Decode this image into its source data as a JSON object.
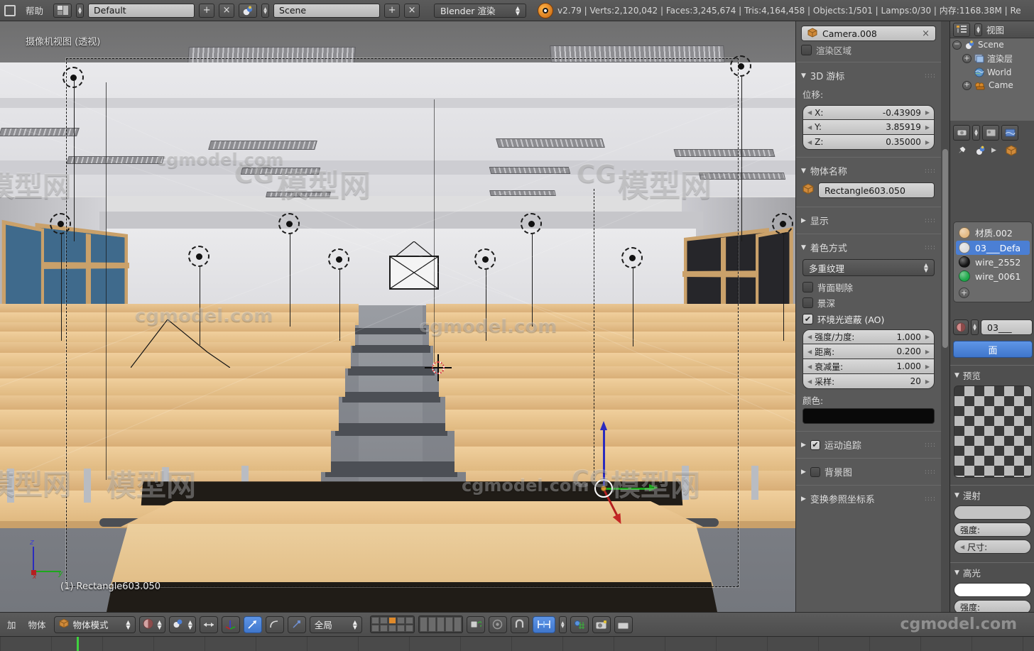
{
  "topbar": {
    "menu_help": "帮助",
    "screen_layout": "Default",
    "scene_name": "Scene",
    "render_engine": "Blender 渲染",
    "version": "v2.79",
    "stats": "v2.79 | Verts:2,120,042 | Faces:3,245,674 | Tris:4,164,458 | Objects:1/501 | Lamps:0/30 | 内存:1168.38M | Re",
    "verts": "Verts:2,120,042",
    "faces": "Faces:3,245,674",
    "tris": "Tris:4,164,458",
    "objects": "Objects:1/501",
    "lamps": "Lamps:0/30",
    "memory": "内存:1168.38M",
    "truncated_tail": "Re",
    "add_label": "+",
    "close_label": "×"
  },
  "viewport": {
    "view_label": "摄像机视图 (透视)",
    "active_object": "(1) Rectangle603.050",
    "axis_x": "x",
    "axis_y": "y",
    "axis_z": "z",
    "watermark_text": "cgmodel.com",
    "watermark_cn": "模型网",
    "watermark_logo": "CG"
  },
  "npanel": {
    "camera_field": "Camera.008",
    "camera_close": "×",
    "render_border_label": "渲染区域",
    "cursor3d": {
      "title": "3D 游标",
      "subtitle": "位移:",
      "fields": [
        {
          "label": "X:",
          "value": "-0.43909"
        },
        {
          "label": "Y:",
          "value": "3.85919"
        },
        {
          "label": "Z:",
          "value": "0.35000"
        }
      ]
    },
    "item": {
      "title": "物体名称",
      "object_name": "Rectangle603.050"
    },
    "display": {
      "title": "显示"
    },
    "shading": {
      "title": "着色方式",
      "mode": "多重纹理",
      "backface_cull": "背面剔除",
      "dof": "景深",
      "ao_label": "环境光遮蔽 (AO)",
      "ao_checked": true,
      "fields": [
        {
          "label": "强度/力度:",
          "value": "1.000"
        },
        {
          "label": "距离:",
          "value": "0.200"
        },
        {
          "label": "衰减量:",
          "value": "1.000"
        },
        {
          "label": "采样:",
          "value": "20"
        }
      ],
      "color_label": "颜色:",
      "color_value": "#090909"
    },
    "motion_tracking": {
      "title": "运动追踪",
      "checked": true
    },
    "background_images": {
      "title": "背景图",
      "checked": false
    },
    "transform_orientations": {
      "title": "变换参照坐标系"
    }
  },
  "rightcol": {
    "outliner": {
      "view_label": "视图",
      "rows": [
        {
          "label": "Scene",
          "icon": "scene-icon",
          "depth": 0
        },
        {
          "label": "渲染层",
          "icon": "renderlayer-icon",
          "depth": 1
        },
        {
          "label": "World",
          "icon": "world-icon",
          "depth": 1
        },
        {
          "label": "Came",
          "icon": "camera-icon",
          "depth": 1
        }
      ]
    },
    "materials": {
      "list": [
        {
          "name": "材质.002",
          "color": "#e3ba84",
          "selected": false
        },
        {
          "name": "03___Defa",
          "color": "#dcdcdc",
          "selected": true
        },
        {
          "name": "wire_2552",
          "color": "#141414",
          "selected": false
        },
        {
          "name": "wire_0061",
          "color": "#1ea84a",
          "selected": false
        }
      ],
      "add_label": "+",
      "active_name": "03___",
      "face_button": "面"
    },
    "preview": {
      "title": "预览"
    },
    "diffuse": {
      "title": "漫射",
      "color": "#c3c3c3",
      "intensity_label": "强度:",
      "size_label": "尺寸:"
    },
    "specular": {
      "title": "高光",
      "color": "#ffffff",
      "intensity_label": "强度:"
    }
  },
  "bottombar": {
    "add_menu": "加",
    "object_menu": "物体",
    "mode": "物体模式",
    "orientation": "全局",
    "icons": [
      "shading-icon",
      "pivot-icon",
      "manipulator-translate-icon",
      "manipulator-rotate-icon",
      "manipulator-scale-icon",
      "snap-magnet-icon",
      "snap-mode-icon",
      "proportional-icon",
      "render-camera-icon",
      "render-animation-icon"
    ]
  }
}
